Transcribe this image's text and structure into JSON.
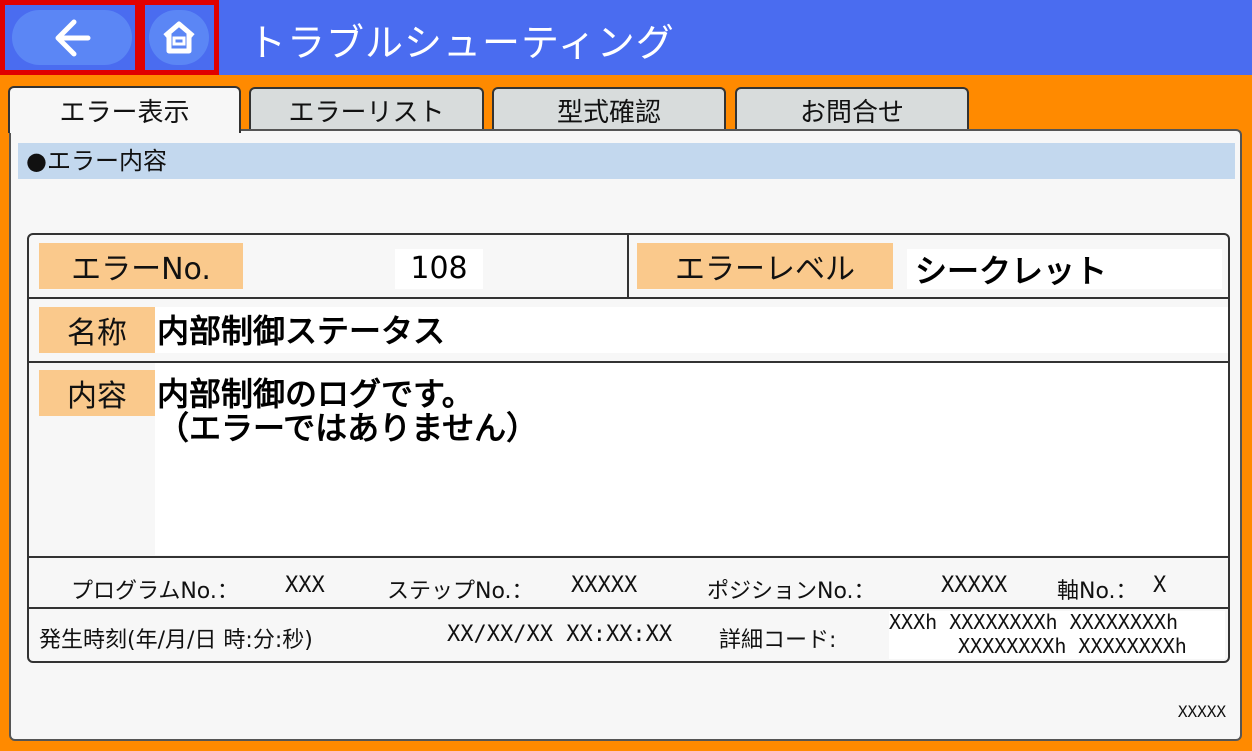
{
  "header": {
    "title": "トラブルシューティング",
    "back_icon": "arrow-left-icon",
    "home_icon": "home-icon"
  },
  "tabs": [
    {
      "label": "エラー表示",
      "active": true
    },
    {
      "label": "エラーリスト",
      "active": false
    },
    {
      "label": "型式確認",
      "active": false
    },
    {
      "label": "お問合せ",
      "active": false
    }
  ],
  "section": {
    "title": "●エラー内容"
  },
  "error": {
    "number_label": "エラーNo.",
    "number_value": "108",
    "level_label": "エラーレベル",
    "level_value": "シークレット",
    "name_label": "名称",
    "name_value": "内部制御ステータス",
    "content_label": "内容",
    "content_line1": "内部制御のログです。",
    "content_line2": "（エラーではありません）"
  },
  "details": {
    "program_label": "プログラムNo.：",
    "program_value": "XXX",
    "step_label": "ステップNo.：",
    "step_value": "XXXXX",
    "position_label": "ポジションNo.：",
    "position_value": "XXXXX",
    "axis_label": "軸No.：",
    "axis_value": "X",
    "time_label": "発生時刻(年/月/日 時:分:秒)",
    "time_value": "XX/XX/XX XX:XX:XX",
    "code_label": "詳細コード:",
    "code_line1": "XXXh XXXXXXXXh XXXXXXXXh",
    "code_line2": "XXXXXXXXh XXXXXXXXh"
  },
  "footer": {
    "code": "XXXXX"
  },
  "colors": {
    "header": "#4a6cf0",
    "background": "#ff8a00",
    "label": "#fac98c",
    "section_bar": "#c3d8ee",
    "highlight": "#e00000"
  }
}
